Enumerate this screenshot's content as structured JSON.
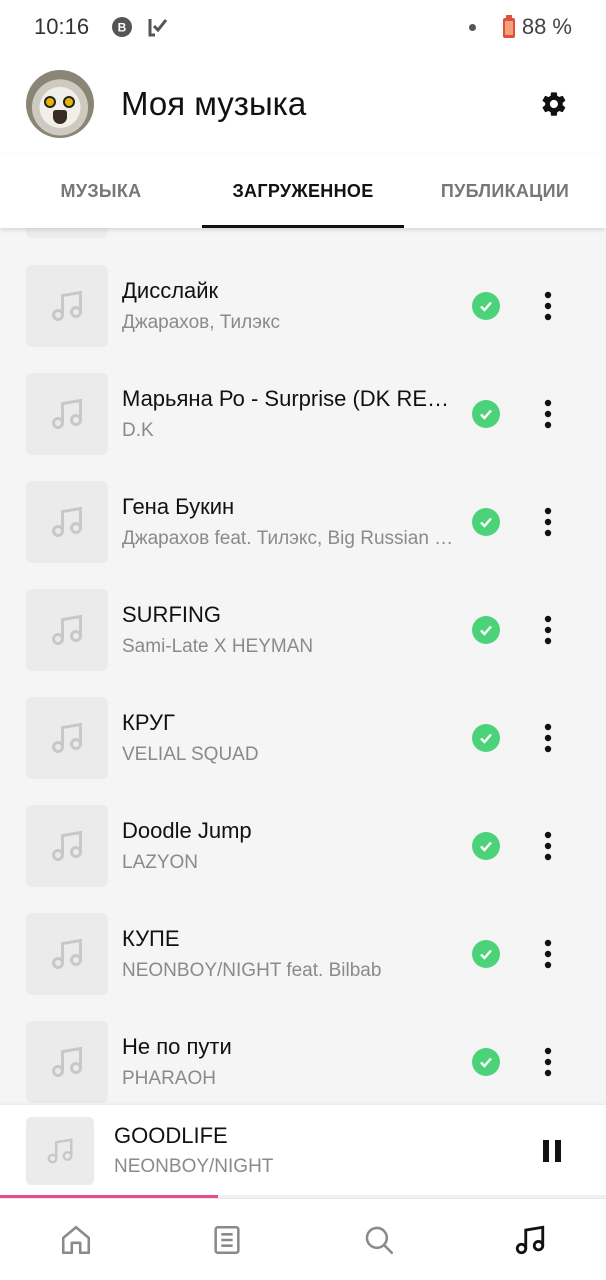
{
  "status_bar": {
    "time": "10:16",
    "battery": "88 %",
    "icons": [
      "vk-notification-icon",
      "checklist-notification-icon",
      "battery-icon"
    ]
  },
  "header": {
    "title": "Моя музыка",
    "avatar_icon": "owl-avatar",
    "settings_icon": "gear-icon"
  },
  "tabs": [
    {
      "label": "МУЗЫКА",
      "active": false
    },
    {
      "label": "ЗАГРУЖЕННОЕ",
      "active": true
    },
    {
      "label": "ПУБЛИКАЦИИ",
      "active": false
    }
  ],
  "tracks": [
    {
      "title": "Дисслайк",
      "artist": "Джарахов, Тилэкс",
      "downloaded": true
    },
    {
      "title": "Марьяна Ро - Surprise (DK REMIX)",
      "artist": "D.K",
      "downloaded": true
    },
    {
      "title": "Гена Букин",
      "artist": "Джарахов feat. Тилэкс, Big Russian Boss",
      "downloaded": true
    },
    {
      "title": "SURFING",
      "artist": "Sami-Late X HEYMAN",
      "downloaded": true
    },
    {
      "title": "КРУГ",
      "artist": "VELIAL SQUAD",
      "downloaded": true
    },
    {
      "title": "Doodle Jump",
      "artist": "LAZYON",
      "downloaded": true
    },
    {
      "title": "КУПЕ",
      "artist": "NEONBOY/NIGHT feat. Bilbab",
      "downloaded": true
    },
    {
      "title": "Не по пути",
      "artist": "PHARAOH",
      "downloaded": true
    }
  ],
  "mini_player": {
    "title": "GOODLIFE",
    "artist": "NEONBOY/NIGHT",
    "state": "playing",
    "progress": 0.36
  },
  "bottom_nav": [
    {
      "name": "home",
      "icon": "home-icon",
      "active": false
    },
    {
      "name": "feed",
      "icon": "feed-icon",
      "active": false
    },
    {
      "name": "search",
      "icon": "search-icon",
      "active": false
    },
    {
      "name": "music",
      "icon": "music-note-icon",
      "active": true
    }
  ],
  "colors": {
    "accent_progress": "#e0508f",
    "download_check": "#4cd37a",
    "list_background": "#f5f5f5"
  }
}
